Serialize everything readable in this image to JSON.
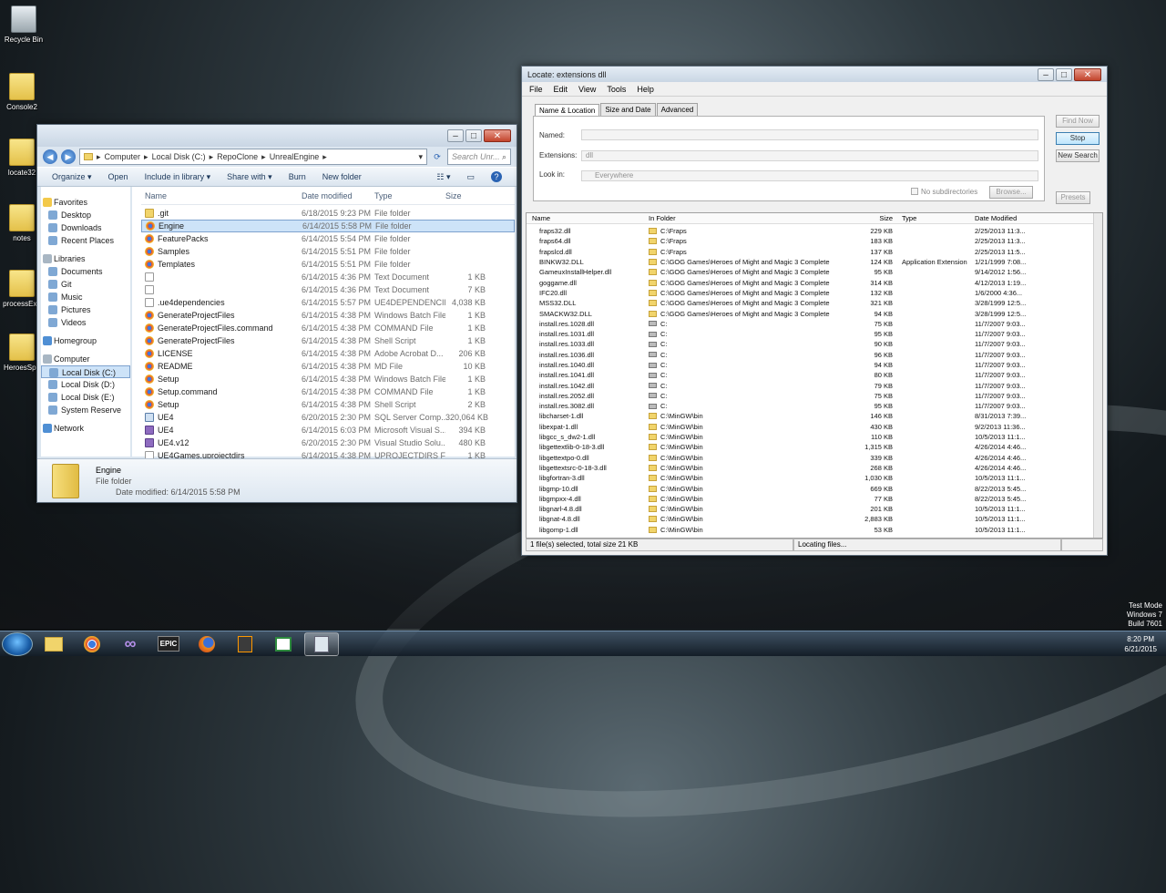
{
  "desktop": {
    "icons": [
      "Recycle Bin",
      "Console2",
      "locate32",
      "notes",
      "processExp",
      "HeroesSpri"
    ]
  },
  "explorer": {
    "breadcrumb": [
      "Computer",
      "Local Disk (C:)",
      "RepoClone",
      "UnrealEngine"
    ],
    "search_placeholder": "Search Unr...",
    "cmd": [
      "Organize ▾",
      "Open",
      "Include in library ▾",
      "Share with ▾",
      "Burn",
      "New folder"
    ],
    "nav": [
      {
        "label": "Favorites",
        "head": true
      },
      {
        "label": "Desktop"
      },
      {
        "label": "Downloads"
      },
      {
        "label": "Recent Places"
      },
      {
        "label": "Libraries",
        "head": true
      },
      {
        "label": "Documents"
      },
      {
        "label": "Git"
      },
      {
        "label": "Music"
      },
      {
        "label": "Pictures"
      },
      {
        "label": "Videos"
      },
      {
        "label": "Homegroup",
        "head": true
      },
      {
        "label": "Computer",
        "head": true
      },
      {
        "label": "Local Disk (C:)",
        "selected": true
      },
      {
        "label": "Local Disk (D:)"
      },
      {
        "label": "Local Disk (E:)"
      },
      {
        "label": "System Reserve"
      },
      {
        "label": "Network",
        "head": true
      }
    ],
    "columns": [
      "Name",
      "Date modified",
      "Type",
      "Size"
    ],
    "files": [
      {
        "name": ".git",
        "date": "6/18/2015 9:23 PM",
        "type": "File folder",
        "size": "",
        "icon": "folder"
      },
      {
        "name": "Engine",
        "date": "6/14/2015 5:58 PM",
        "type": "File folder",
        "size": "",
        "icon": "chrome",
        "selected": true
      },
      {
        "name": "FeaturePacks",
        "date": "6/14/2015 5:54 PM",
        "type": "File folder",
        "size": "",
        "icon": "chrome"
      },
      {
        "name": "Samples",
        "date": "6/14/2015 5:51 PM",
        "type": "File folder",
        "size": "",
        "icon": "chrome"
      },
      {
        "name": "Templates",
        "date": "6/14/2015 5:51 PM",
        "type": "File folder",
        "size": "",
        "icon": "chrome"
      },
      {
        "name": "",
        "date": "6/14/2015 4:36 PM",
        "type": "Text Document",
        "size": "1 KB",
        "icon": "doc"
      },
      {
        "name": "",
        "date": "6/14/2015 4:36 PM",
        "type": "Text Document",
        "size": "7 KB",
        "icon": "doc"
      },
      {
        "name": ".ue4dependencies",
        "date": "6/14/2015 5:57 PM",
        "type": "UE4DEPENDENCIE...",
        "size": "4,038 KB",
        "icon": "doc"
      },
      {
        "name": "GenerateProjectFiles",
        "date": "6/14/2015 4:38 PM",
        "type": "Windows Batch File",
        "size": "1 KB",
        "icon": "chrome"
      },
      {
        "name": "GenerateProjectFiles.command",
        "date": "6/14/2015 4:38 PM",
        "type": "COMMAND File",
        "size": "1 KB",
        "icon": "chrome"
      },
      {
        "name": "GenerateProjectFiles",
        "date": "6/14/2015 4:38 PM",
        "type": "Shell Script",
        "size": "1 KB",
        "icon": "chrome"
      },
      {
        "name": "LICENSE",
        "date": "6/14/2015 4:38 PM",
        "type": "Adobe Acrobat D...",
        "size": "206 KB",
        "icon": "chrome"
      },
      {
        "name": "README",
        "date": "6/14/2015 4:38 PM",
        "type": "MD File",
        "size": "10 KB",
        "icon": "chrome"
      },
      {
        "name": "Setup",
        "date": "6/14/2015 4:38 PM",
        "type": "Windows Batch File",
        "size": "1 KB",
        "icon": "chrome"
      },
      {
        "name": "Setup.command",
        "date": "6/14/2015 4:38 PM",
        "type": "COMMAND File",
        "size": "1 KB",
        "icon": "chrome"
      },
      {
        "name": "Setup",
        "date": "6/14/2015 4:38 PM",
        "type": "Shell Script",
        "size": "2 KB",
        "icon": "chrome"
      },
      {
        "name": "UE4",
        "date": "6/20/2015 2:30 PM",
        "type": "SQL Server Comp...",
        "size": "320,064 KB",
        "icon": "exe"
      },
      {
        "name": "UE4",
        "date": "6/14/2015 6:03 PM",
        "type": "Microsoft Visual S...",
        "size": "394 KB",
        "icon": "vs"
      },
      {
        "name": "UE4.v12",
        "date": "6/20/2015 2:30 PM",
        "type": "Visual Studio Solu...",
        "size": "480 KB",
        "icon": "vs"
      },
      {
        "name": "UE4Games.uprojectdirs",
        "date": "6/14/2015 4:38 PM",
        "type": "UPROJECTDIRS File",
        "size": "1 KB",
        "icon": "doc"
      }
    ],
    "details": {
      "name": "Engine",
      "type": "File folder",
      "date_label": "Date modified: 6/14/2015 5:58 PM"
    }
  },
  "locate": {
    "title": "Locate: extensions dll",
    "menu": [
      "File",
      "Edit",
      "View",
      "Tools",
      "Help"
    ],
    "tabs": [
      "Name & Location",
      "Size and Date",
      "Advanced"
    ],
    "named_label": "Named:",
    "ext_label": "Extensions:",
    "ext_value": "dll",
    "lookin_label": "Look in:",
    "lookin_value": "Everywhere",
    "no_subdirs": "No subdirectories",
    "browse": "Browse...",
    "buttons": [
      "Find Now",
      "Stop",
      "New Search",
      "Presets"
    ],
    "columns": [
      "Name",
      "In Folder",
      "Size",
      "Type",
      "Date Modified"
    ],
    "rows": [
      [
        "fraps32.dll",
        "C:\\Fraps",
        "229 KB",
        "",
        "2/25/2013 11:3..."
      ],
      [
        "fraps64.dll",
        "C:\\Fraps",
        "183 KB",
        "",
        "2/25/2013 11:3..."
      ],
      [
        "frapslcd.dll",
        "C:\\Fraps",
        "137 KB",
        "",
        "2/25/2013 11:5..."
      ],
      [
        "BINKW32.DLL",
        "C:\\GOG Games\\Heroes of Might and Magic 3 Complete",
        "124 KB",
        "Application Extension",
        "1/21/1999 7:08..."
      ],
      [
        "GameuxInstallHelper.dll",
        "C:\\GOG Games\\Heroes of Might and Magic 3 Complete",
        "95 KB",
        "",
        "9/14/2012 1:56..."
      ],
      [
        "goggame.dll",
        "C:\\GOG Games\\Heroes of Might and Magic 3 Complete",
        "314 KB",
        "",
        "4/12/2013 1:19..."
      ],
      [
        "IFC20.dll",
        "C:\\GOG Games\\Heroes of Might and Magic 3 Complete",
        "132 KB",
        "",
        "1/6/2000 4:36..."
      ],
      [
        "MSS32.DLL",
        "C:\\GOG Games\\Heroes of Might and Magic 3 Complete",
        "321 KB",
        "",
        "3/28/1999 12:5..."
      ],
      [
        "SMACKW32.DLL",
        "C:\\GOG Games\\Heroes of Might and Magic 3 Complete",
        "94 KB",
        "",
        "3/28/1999 12:5..."
      ],
      [
        "install.res.1028.dll",
        "C:",
        "75 KB",
        "",
        "11/7/2007 9:03..."
      ],
      [
        "install.res.1031.dll",
        "C:",
        "95 KB",
        "",
        "11/7/2007 9:03..."
      ],
      [
        "install.res.1033.dll",
        "C:",
        "90 KB",
        "",
        "11/7/2007 9:03..."
      ],
      [
        "install.res.1036.dll",
        "C:",
        "96 KB",
        "",
        "11/7/2007 9:03..."
      ],
      [
        "install.res.1040.dll",
        "C:",
        "94 KB",
        "",
        "11/7/2007 9:03..."
      ],
      [
        "install.res.1041.dll",
        "C:",
        "80 KB",
        "",
        "11/7/2007 9:03..."
      ],
      [
        "install.res.1042.dll",
        "C:",
        "79 KB",
        "",
        "11/7/2007 9:03..."
      ],
      [
        "install.res.2052.dll",
        "C:",
        "75 KB",
        "",
        "11/7/2007 9:03..."
      ],
      [
        "install.res.3082.dll",
        "C:",
        "95 KB",
        "",
        "11/7/2007 9:03..."
      ],
      [
        "libcharset-1.dll",
        "C:\\MinGW\\bin",
        "146 KB",
        "",
        "8/31/2013 7:39..."
      ],
      [
        "libexpat-1.dll",
        "C:\\MinGW\\bin",
        "430 KB",
        "",
        "9/2/2013 11:36..."
      ],
      [
        "libgcc_s_dw2-1.dll",
        "C:\\MinGW\\bin",
        "110 KB",
        "",
        "10/5/2013 11:1..."
      ],
      [
        "libgettextlib-0-18-3.dll",
        "C:\\MinGW\\bin",
        "1,315 KB",
        "",
        "4/26/2014 4:46..."
      ],
      [
        "libgettextpo-0.dll",
        "C:\\MinGW\\bin",
        "339 KB",
        "",
        "4/26/2014 4:46..."
      ],
      [
        "libgettextsrc-0-18-3.dll",
        "C:\\MinGW\\bin",
        "268 KB",
        "",
        "4/26/2014 4:46..."
      ],
      [
        "libgfortran-3.dll",
        "C:\\MinGW\\bin",
        "1,030 KB",
        "",
        "10/5/2013 11:1..."
      ],
      [
        "libgmp-10.dll",
        "C:\\MinGW\\bin",
        "669 KB",
        "",
        "8/22/2013 5:45..."
      ],
      [
        "libgmpxx-4.dll",
        "C:\\MinGW\\bin",
        "77 KB",
        "",
        "8/22/2013 5:45..."
      ],
      [
        "libgnarl-4.8.dll",
        "C:\\MinGW\\bin",
        "201 KB",
        "",
        "10/5/2013 11:1..."
      ],
      [
        "libgnat-4.8.dll",
        "C:\\MinGW\\bin",
        "2,883 KB",
        "",
        "10/5/2013 11:1..."
      ],
      [
        "libgomp-1.dll",
        "C:\\MinGW\\bin",
        "53 KB",
        "",
        "10/5/2013 11:1..."
      ]
    ],
    "status_left": "1 file(s) selected, total size 21 KB",
    "status_right": "Locating files..."
  },
  "tray": {
    "testmode": [
      "Test Mode",
      "Windows 7",
      "Build 7601"
    ],
    "time": "8:20 PM",
    "date": "6/21/2015"
  },
  "taskbar": {
    "epic": "EPIC"
  }
}
